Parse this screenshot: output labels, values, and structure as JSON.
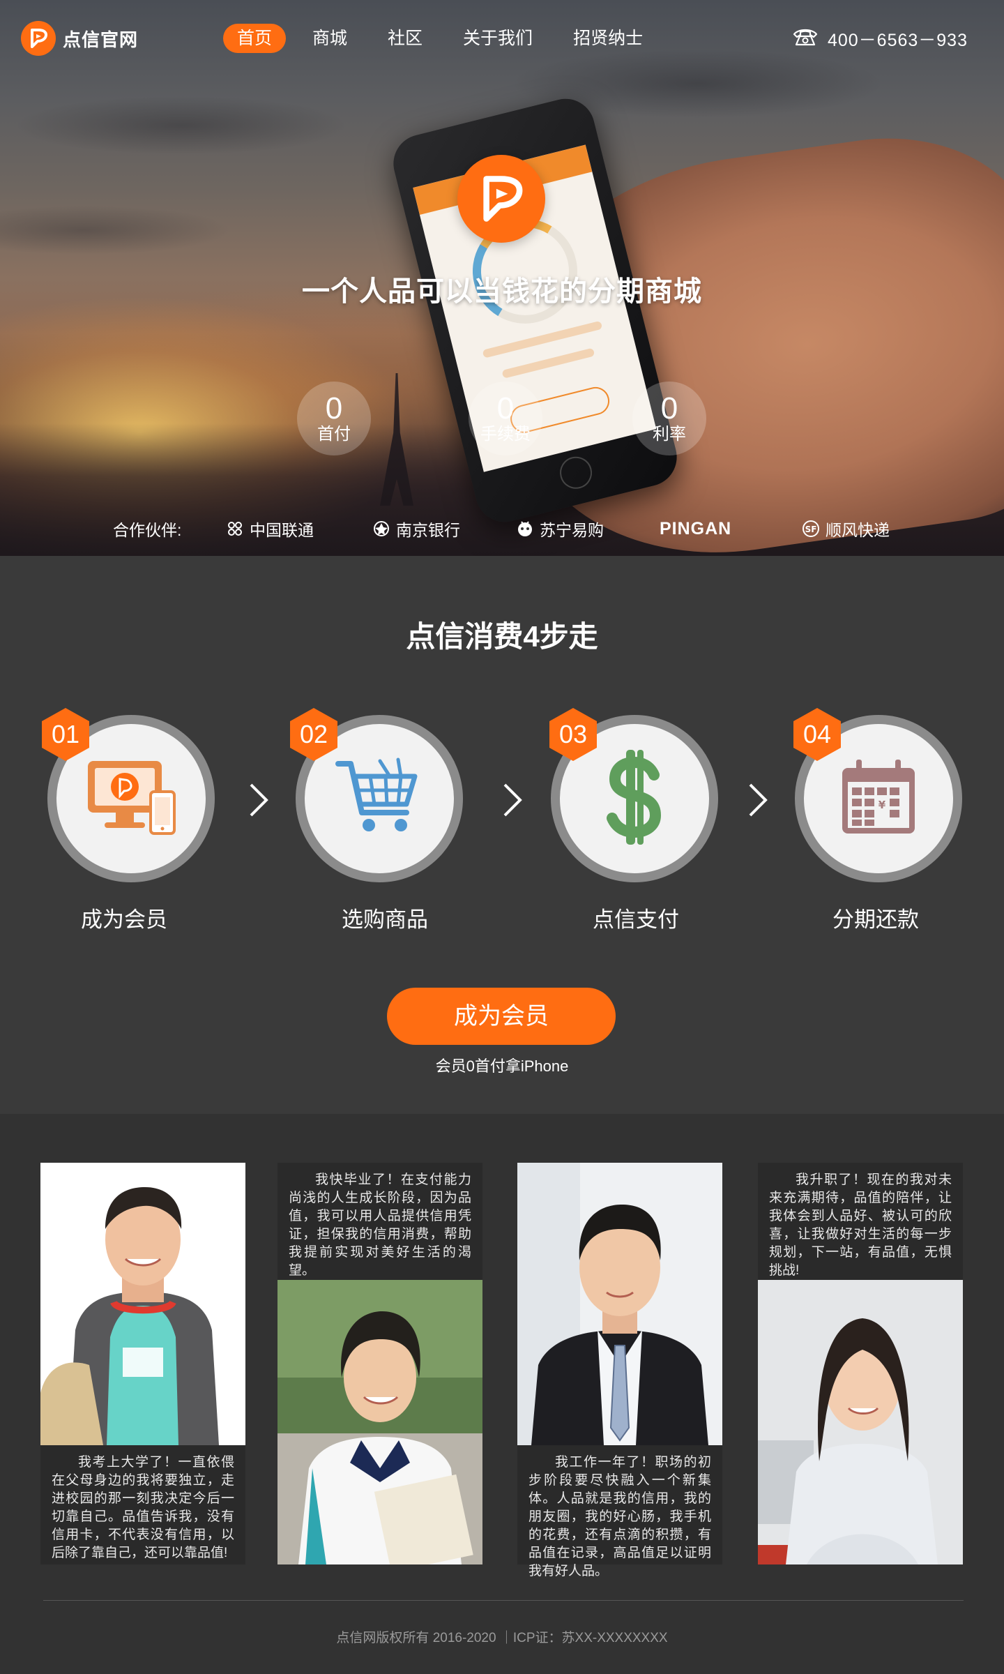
{
  "nav": {
    "brand": "点信官网",
    "items": [
      {
        "label": "首页",
        "active": true
      },
      {
        "label": "商城",
        "active": false
      },
      {
        "label": "社区",
        "active": false
      },
      {
        "label": "关于我们",
        "active": false
      },
      {
        "label": "招贤纳士",
        "active": false
      }
    ],
    "phone": "400－6563－933",
    "phone_icon": "telephone-icon"
  },
  "hero": {
    "slogan": "一个人品可以当钱花的分期商城",
    "stats": [
      {
        "value": "0",
        "label": "首付"
      },
      {
        "value": "0",
        "label": "手续费"
      },
      {
        "value": "0",
        "label": "利率"
      }
    ],
    "partners_label": "合作伙伴:",
    "partners": [
      {
        "name": "中国联通",
        "icon": "china-unicom-icon"
      },
      {
        "name": "南京银行",
        "icon": "nanjing-bank-icon"
      },
      {
        "name": "苏宁易购",
        "icon": "suning-icon"
      },
      {
        "name": "PINGAN",
        "icon": "pingan-logo"
      },
      {
        "name": "顺风快递",
        "icon": "sf-express-icon"
      }
    ]
  },
  "steps": {
    "title": "点信消费4步走",
    "items": [
      {
        "number": "01",
        "label": "成为会员",
        "icon": "computer-phone-icon"
      },
      {
        "number": "02",
        "label": "选购商品",
        "icon": "shopping-cart-icon"
      },
      {
        "number": "03",
        "label": "点信支付",
        "icon": "dollar-icon"
      },
      {
        "number": "04",
        "label": "分期还款",
        "icon": "calendar-icon"
      }
    ],
    "cta_label": "成为会员",
    "cta_note": "会员0首付拿iPhone"
  },
  "testimonials": [
    {
      "text": "我考上大学了！一直依偎在父母身边的我将要独立，走进校园的那一刻我决定今后一切靠自己。品值告诉我，没有信用卡，不代表没有信用，以后除了靠自己，还可以靠品值!"
    },
    {
      "text": "我快毕业了！在支付能力尚浅的人生成长阶段，因为品值，我可以用人品提供信用凭证，担保我的信用消费，帮助我提前实现对美好生活的渴望。"
    },
    {
      "text": "我工作一年了！职场的初步阶段要尽快融入一个新集体。人品就是我的信用，我的朋友圈，我的好心肠，我手机的花费，还有点滴的积攒，有品值在记录，高品值足以证明我有好人品。"
    },
    {
      "text": "我升职了！现在的我对未来充满期待，品值的陪伴，让我体会到人品好、被认可的欣喜，让我做好对生活的每一步规划，下一站，有品值，无惧挑战!"
    }
  ],
  "footer": {
    "text": "点信网版权所有 2016-2020 ｜ICP证：苏XX-XXXXXXXX"
  },
  "colors": {
    "accent": "#ff6d12",
    "steps_bg": "#3a3a3a",
    "testimonials_bg": "#323232"
  }
}
